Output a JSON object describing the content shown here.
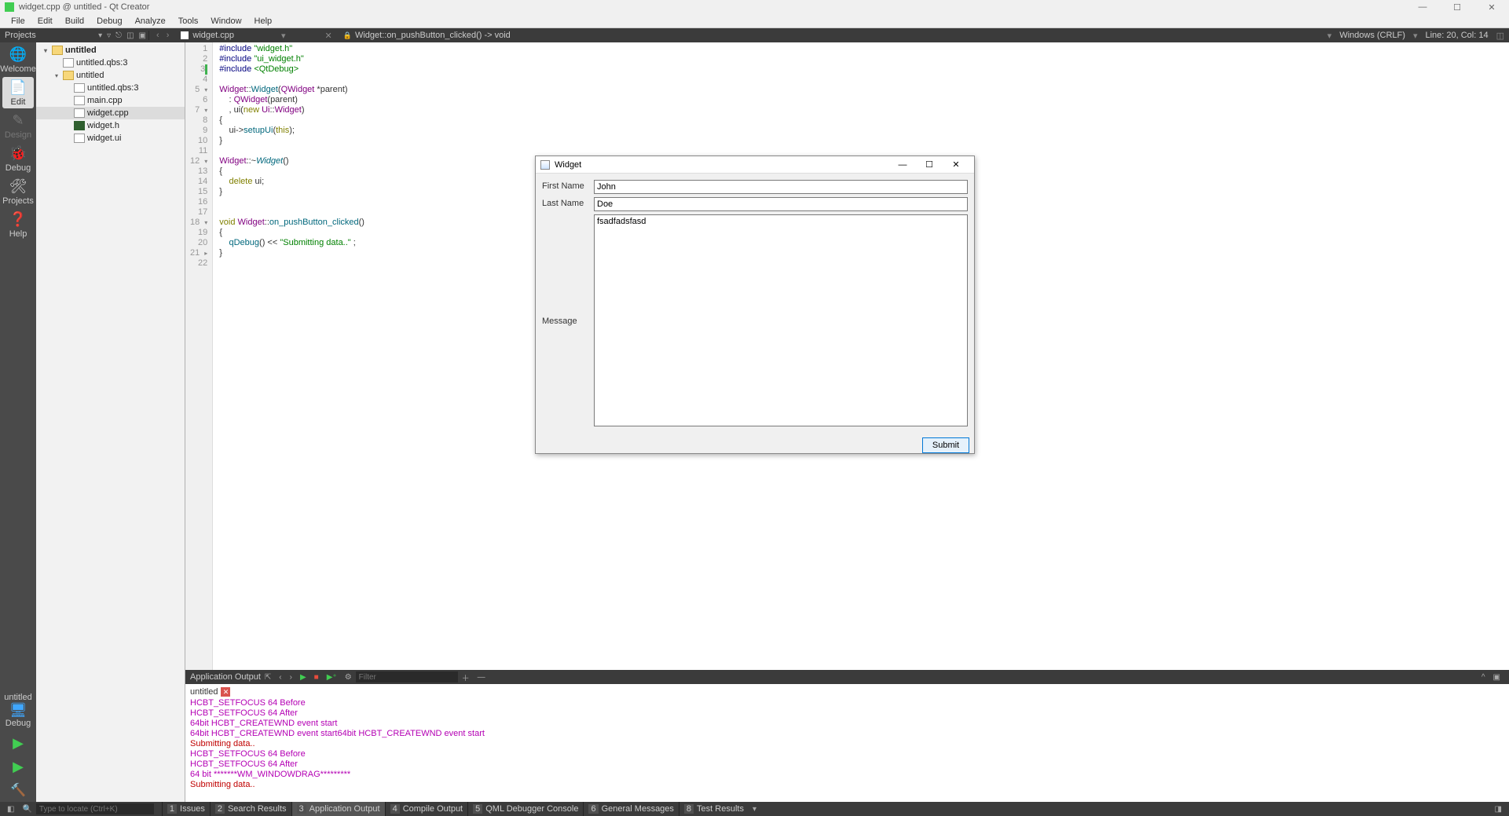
{
  "window_title": "widget.cpp @ untitled - Qt Creator",
  "menus": [
    "File",
    "Edit",
    "Build",
    "Debug",
    "Analyze",
    "Tools",
    "Window",
    "Help"
  ],
  "projects_label": "Projects",
  "editor_tab": "widget.cpp",
  "crumb": "Widget::on_pushButton_clicked() -> void",
  "encoding": "Windows (CRLF)",
  "cursor": "Line: 20, Col: 14",
  "sidebar_modes": [
    {
      "label": "Welcome",
      "glyph": "🌐"
    },
    {
      "label": "Edit",
      "glyph": "📄",
      "active": true
    },
    {
      "label": "Design",
      "glyph": "✎",
      "disabled": true
    },
    {
      "label": "Debug",
      "glyph": "🐞"
    },
    {
      "label": "Projects",
      "glyph": "🛠"
    },
    {
      "label": "Help",
      "glyph": "❓"
    }
  ],
  "kit": {
    "name": "untitled",
    "cfg": "Debug"
  },
  "tree": [
    {
      "indent": 0,
      "twisty": "▾",
      "icon": "folder",
      "text": "untitled",
      "bold": true
    },
    {
      "indent": 1,
      "twisty": "",
      "icon": "qbs",
      "text": "untitled.qbs:3"
    },
    {
      "indent": 1,
      "twisty": "▾",
      "icon": "folder",
      "text": "untitled"
    },
    {
      "indent": 2,
      "twisty": "",
      "icon": "qbs",
      "text": "untitled.qbs:3"
    },
    {
      "indent": 2,
      "twisty": "",
      "icon": "cpp",
      "text": "main.cpp"
    },
    {
      "indent": 2,
      "twisty": "",
      "icon": "cpp",
      "text": "widget.cpp",
      "sel": true
    },
    {
      "indent": 2,
      "twisty": "",
      "icon": "h",
      "text": "widget.h"
    },
    {
      "indent": 2,
      "twisty": "",
      "icon": "ui",
      "text": "widget.ui"
    }
  ],
  "code_lines": [
    {
      "n": 1,
      "html": "<span class='pp'>#include</span> <span class='str'>\"widget.h\"</span>"
    },
    {
      "n": 2,
      "html": "<span class='pp'>#include</span> <span class='str'>\"ui_widget.h\"</span>"
    },
    {
      "n": 3,
      "html": "<span class='pp'>#include</span> <span class='str'>&lt;QtDebug&gt;</span>",
      "marker": true
    },
    {
      "n": 4,
      "html": ""
    },
    {
      "n": 5,
      "html": "<span class='type'>Widget</span>::<span class='func'>Widget</span>(<span class='type'>QWidget</span> *parent)",
      "fold": "▾"
    },
    {
      "n": 6,
      "html": "    : <span class='type'>QWidget</span>(parent)"
    },
    {
      "n": 7,
      "html": "    , ui(<span class='kw'>new</span> <span class='type'>Ui</span>::<span class='type'>Widget</span>)",
      "fold": "▾"
    },
    {
      "n": 8,
      "html": "{"
    },
    {
      "n": 9,
      "html": "    ui-&gt;<span class='func'>setupUi</span>(<span class='kw'>this</span>);"
    },
    {
      "n": 10,
      "html": "}"
    },
    {
      "n": 11,
      "html": ""
    },
    {
      "n": 12,
      "html": "<span class='type'>Widget</span>::~<span class='func it'>Widget</span>()",
      "fold": "▾"
    },
    {
      "n": 13,
      "html": "{"
    },
    {
      "n": 14,
      "html": "    <span class='kw'>delete</span> ui;"
    },
    {
      "n": 15,
      "html": "}"
    },
    {
      "n": 16,
      "html": ""
    },
    {
      "n": 17,
      "html": ""
    },
    {
      "n": 18,
      "html": "<span class='kw'>void</span> <span class='type'>Widget</span>::<span class='func'>on_pushButton_clicked</span>()",
      "fold": "▾"
    },
    {
      "n": 19,
      "html": "{"
    },
    {
      "n": 20,
      "html": "    <span class='func'>qDebug</span>() &lt;&lt; <span class='str'>\"Submitting data..\"</span> ;"
    },
    {
      "n": 21,
      "html": "}",
      "fold": "▸"
    },
    {
      "n": 22,
      "html": ""
    }
  ],
  "output_panel": {
    "title": "Application Output",
    "tab": "untitled",
    "filter_placeholder": "Filter",
    "lines": [
      {
        "t": " HCBT_SETFOCUS 64 Before",
        "c": "outline"
      },
      {
        "t": " HCBT_SETFOCUS 64 After",
        "c": "outline"
      },
      {
        "t": "64bit HCBT_CREATEWND event start",
        "c": "outline"
      },
      {
        "t": "64bit HCBT_CREATEWND event start64bit HCBT_CREATEWND event start",
        "c": "outline"
      },
      {
        "t": "Submitting data..",
        "c": "outline red"
      },
      {
        "t": " HCBT_SETFOCUS 64 Before",
        "c": "outline"
      },
      {
        "t": " HCBT_SETFOCUS 64 After",
        "c": "outline"
      },
      {
        "t": "64 bit *******WM_WINDOWDRAG*********",
        "c": "outline"
      },
      {
        "t": "Submitting data..",
        "c": "outline red"
      }
    ]
  },
  "statusbar": {
    "locator_placeholder": "Type to locate (Ctrl+K)",
    "tabs": [
      {
        "n": "1",
        "t": "Issues"
      },
      {
        "n": "2",
        "t": "Search Results"
      },
      {
        "n": "3",
        "t": "Application Output",
        "active": true
      },
      {
        "n": "4",
        "t": "Compile Output"
      },
      {
        "n": "5",
        "t": "QML Debugger Console"
      },
      {
        "n": "6",
        "t": "General Messages"
      },
      {
        "n": "8",
        "t": "Test Results"
      }
    ]
  },
  "widget_dialog": {
    "title": "Widget",
    "first_label": "First Name",
    "first_value": "John",
    "last_label": "Last Name",
    "last_value": "Doe",
    "msg_label": "Message",
    "msg_value": "fsadfadsfasd",
    "submit": "Submit"
  }
}
